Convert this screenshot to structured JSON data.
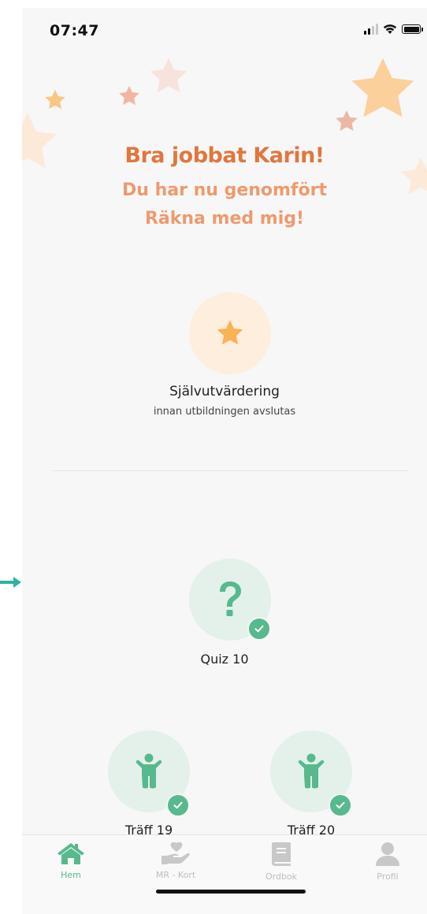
{
  "status_bar": {
    "time": "07:47"
  },
  "headline": {
    "greeting": "Bra jobbat Karin!",
    "line2": "Du har nu genomfört",
    "line3": "Räkna med mig!"
  },
  "self_assessment": {
    "title": "Självutvärdering",
    "subtitle": "innan utbildningen avslutas",
    "icon": "star-icon"
  },
  "quiz": {
    "label": "Quiz 10",
    "icon": "question-icon",
    "completed": true
  },
  "meetings": [
    {
      "label": "Träff 19",
      "icon": "child-figure-icon",
      "completed": true
    },
    {
      "label": "Träff 20",
      "icon": "child-figure-icon",
      "completed": true
    }
  ],
  "tabbar": {
    "items": [
      {
        "label": "Hem",
        "icon": "home-icon",
        "active": true
      },
      {
        "label": "MR - Kort",
        "icon": "heart-hand-icon",
        "active": false
      },
      {
        "label": "Ordbok",
        "icon": "book-icon",
        "active": false
      },
      {
        "label": "Profil",
        "icon": "profile-icon",
        "active": false
      }
    ]
  },
  "colors": {
    "accent_orange": "#e0773f",
    "accent_orange_light": "#ee9a6e",
    "accent_green": "#57b98d",
    "star_yellow": "#fbbf6a",
    "background": "#f7f7f7"
  }
}
